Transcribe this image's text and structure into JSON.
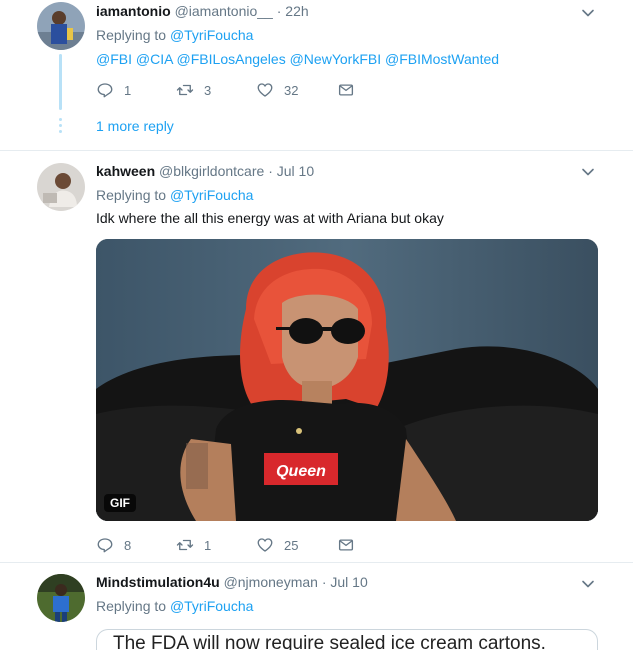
{
  "tweets": [
    {
      "name": "iamantonio",
      "handle": "@iamantonio__",
      "time": "22h",
      "replying_prefix": "Replying to",
      "replying_to": "@TyriFoucha",
      "text": "@FBI @CIA @FBILosAngeles @NewYorkFBI @FBIMostWanted",
      "replies": "1",
      "retweets": "3",
      "likes": "32",
      "more_replies": "1 more reply"
    },
    {
      "name": "kahween",
      "handle": "@blkgirldontcare",
      "time": "Jul 10",
      "replying_prefix": "Replying to",
      "replying_to": "@TyriFoucha",
      "text": "Idk where the all this energy was at with Ariana but okay",
      "media_badge": "GIF",
      "shirt_text": "Queen",
      "replies": "8",
      "retweets": "1",
      "likes": "25"
    },
    {
      "name": "Mindstimulation4u",
      "handle": "@njmoneyman",
      "time": "Jul 10",
      "replying_prefix": "Replying to",
      "replying_to": "@TyriFoucha",
      "quote_text": "The FDA will now require sealed ice cream cartons."
    }
  ],
  "separator": "·",
  "colors": {
    "link": "#1da1f2",
    "muted": "#657786",
    "thread": "#b8e1f7",
    "border": "#e6ecf0"
  },
  "icons": [
    "reply-icon",
    "retweet-icon",
    "like-icon",
    "direct-message-icon",
    "chevron-down-icon"
  ]
}
